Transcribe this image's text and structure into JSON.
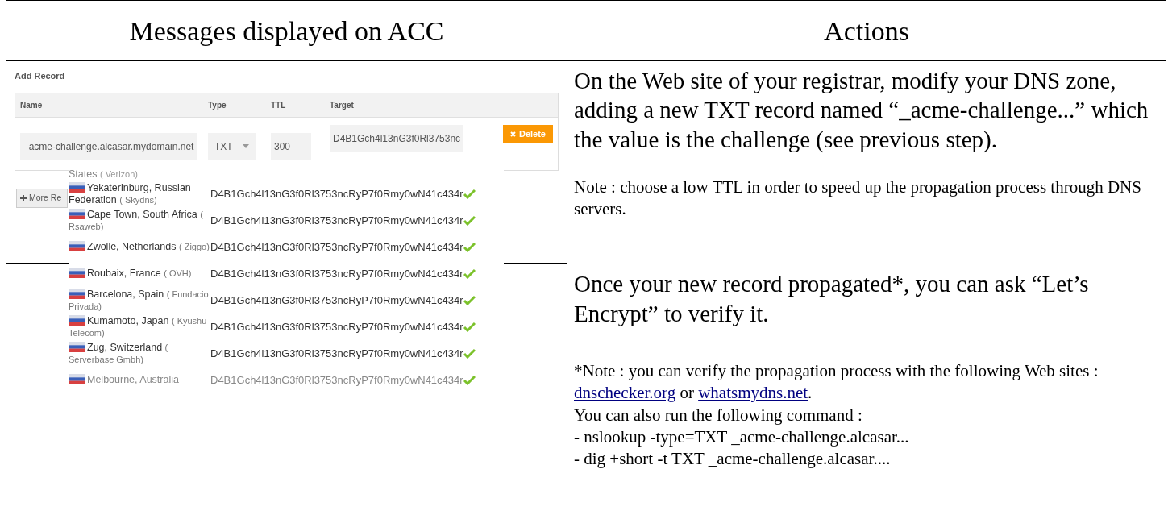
{
  "table": {
    "columns": [
      "Messages displayed on ACC",
      "Actions"
    ]
  },
  "add_record": {
    "title": "Add Record",
    "columns": [
      "Name",
      "Type",
      "TTL",
      "Target"
    ],
    "row": {
      "name": "_acme-challenge.alcasar.mydomain.net",
      "type": "TXT",
      "ttl": "300",
      "target": "D4B1Gch4l13nG3f0Rl3753nc"
    },
    "delete_button": "Delete",
    "more_button": "More Re"
  },
  "propagation": {
    "rows": [
      {
        "location": "States",
        "provider": "( Verizon)",
        "faded": true
      },
      {
        "location": "Yekaterinburg, Russian Federation",
        "provider": "( Skydns)",
        "value": "D4B1Gch4l13nG3f0Rl3753ncRyP7f0Rmy0wN41c434r",
        "faded": false
      },
      {
        "location": "Cape Town, South Africa",
        "provider": "( Rsaweb)",
        "value": "D4B1Gch4l13nG3f0Rl3753ncRyP7f0Rmy0wN41c434r",
        "faded": false
      },
      {
        "location": "Zwolle, Netherlands",
        "provider": "( Ziggo)",
        "value": "D4B1Gch4l13nG3f0Rl3753ncRyP7f0Rmy0wN41c434r",
        "faded": false
      },
      {
        "location": "Roubaix, France",
        "provider": "( OVH)",
        "value": "D4B1Gch4l13nG3f0Rl3753ncRyP7f0Rmy0wN41c434r",
        "faded": false
      },
      {
        "location": "Barcelona, Spain",
        "provider": "( Fundacio Privada)",
        "value": "D4B1Gch4l13nG3f0Rl3753ncRyP7f0Rmy0wN41c434r",
        "faded": false
      },
      {
        "location": "Kumamoto, Japan",
        "provider": "( Kyushu Telecom)",
        "value": "D4B1Gch4l13nG3f0Rl3753ncRyP7f0Rmy0wN41c434r",
        "faded": false
      },
      {
        "location": "Zug, Switzerland",
        "provider": "( Serverbase Gmbh)",
        "value": "D4B1Gch4l13nG3f0Rl3753ncRyP7f0Rmy0wN41c434r",
        "faded": false
      },
      {
        "location": "Melbourne, Australia",
        "value": "D4B1Gch4l13nG3f0Rl3753ncRyP7f0Rmy0wN41c434r",
        "faded": true
      }
    ]
  },
  "actions": [
    {
      "main": "On the Web site of your registrar, modify your DNS zone, adding a new TXT record named “_acme-challenge...” which the value is the challenge (see previous step).",
      "notes": [
        {
          "parts": [
            {
              "kind": "text",
              "text": "Note : choose a low TTL in order to speed up the propagation process through DNS servers."
            }
          ]
        }
      ]
    },
    {
      "main": "Once your new record propagated*, you can ask “Let’s Encrypt” to verify it.",
      "notes": [
        {
          "parts": [
            {
              "kind": "text",
              "text": "*Note : you can verify the propagation process with the following Web sites : "
            },
            {
              "kind": "link",
              "text": "dnschecker.org"
            },
            {
              "kind": "text",
              "text": " or "
            },
            {
              "kind": "link",
              "text": "whatsmydns.net"
            },
            {
              "kind": "text",
              "text": "."
            }
          ]
        },
        {
          "parts": [
            {
              "kind": "text",
              "text": "You can also run the following command :"
            }
          ]
        },
        {
          "parts": [
            {
              "kind": "text",
              "text": "- nslookup -type=TXT _acme-challenge.alcasar..."
            }
          ]
        },
        {
          "parts": [
            {
              "kind": "text",
              "text": "- dig +short -t TXT _acme-challenge.alcasar...."
            }
          ]
        }
      ]
    }
  ]
}
